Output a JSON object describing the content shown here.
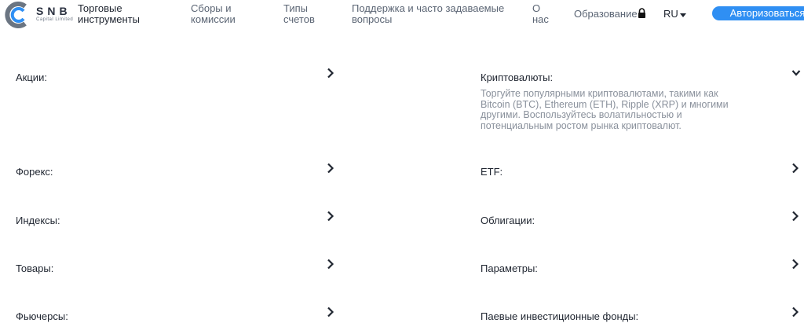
{
  "header": {
    "logo": {
      "name": "SNB",
      "subtitle": "Capital Limited"
    },
    "nav": [
      {
        "label": "Торговые инструменты",
        "active": true
      },
      {
        "label": "Сборы и комиссии",
        "active": false
      },
      {
        "label": "Типы счетов",
        "active": false
      },
      {
        "label": "Поддержка и часто задаваемые вопросы",
        "active": false
      },
      {
        "label": "О нас",
        "active": false
      }
    ],
    "education_label": "Образование",
    "language": "RU",
    "login_label": "Авторизоваться"
  },
  "accordion": {
    "left": [
      {
        "title": "Акции:"
      },
      {
        "title": "Форекс:"
      },
      {
        "title": "Индексы:"
      },
      {
        "title": "Товары:"
      },
      {
        "title": "Фьючерсы:"
      }
    ],
    "right": [
      {
        "title": "Криптовалюты:",
        "expanded": true,
        "description": "Торгуйте популярными криптовалютами, такими как Bitcoin (BTC), Ethereum (ETH), Ripple (XRP) и многими другими. Воспользуйтесь волатильностью и потенциальным ростом рынка криптовалют."
      },
      {
        "title": "ETF:"
      },
      {
        "title": "Облигации:"
      },
      {
        "title": "Параметры:"
      },
      {
        "title": "Паевые инвестиционные фонды:"
      }
    ]
  },
  "colors": {
    "accent": "#2f8ff3",
    "text": "#1f2530",
    "muted": "#8a919c"
  },
  "icons": {
    "expand": "chevron-right-icon",
    "collapse": "chevron-down-icon",
    "lock": "lock-icon",
    "caret": "caret-down-icon"
  }
}
